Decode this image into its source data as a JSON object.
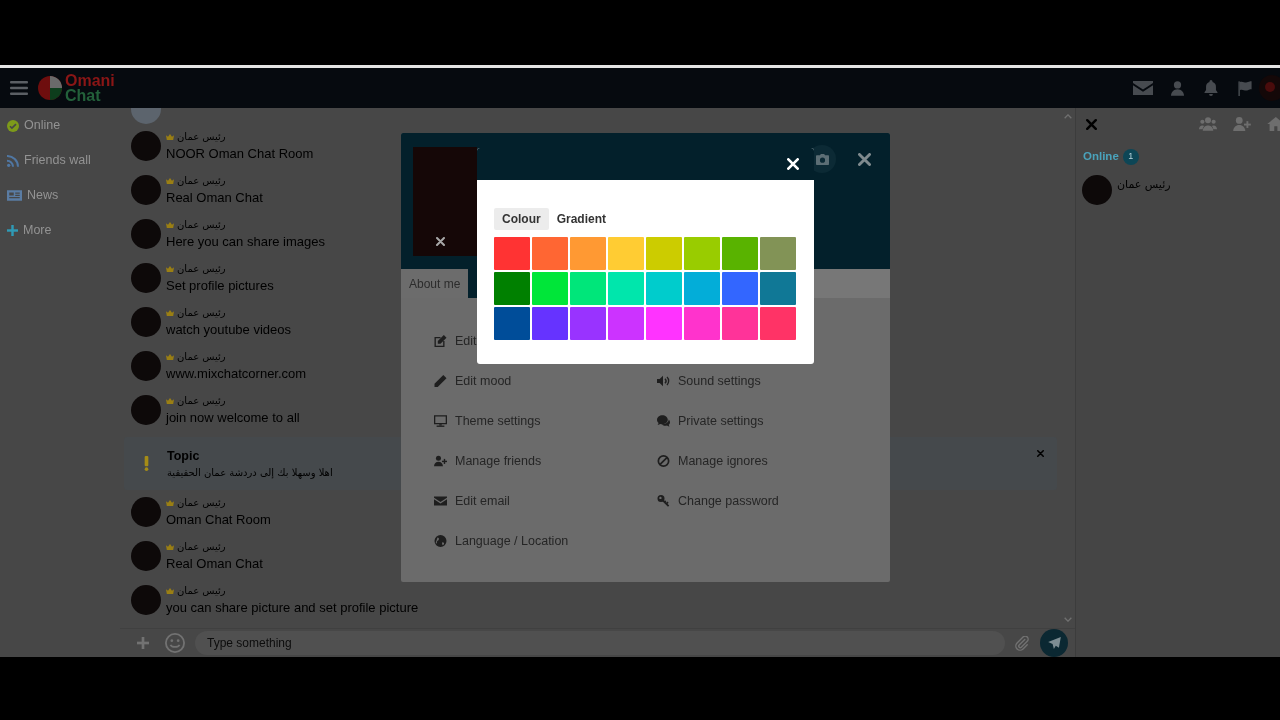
{
  "header": {
    "logo": [
      "Omani",
      "Chat"
    ]
  },
  "sidebar": {
    "items": [
      {
        "label": "Online",
        "kind": "online"
      },
      {
        "label": "Friends wall",
        "kind": "wall"
      },
      {
        "label": "News",
        "kind": "news"
      },
      {
        "label": "More",
        "kind": "more"
      }
    ]
  },
  "chat": {
    "messages": [
      {
        "kind": "message",
        "user": "رئيس عمان",
        "text": "NOOR Oman Chat Room"
      },
      {
        "kind": "message",
        "user": "رئيس عمان",
        "text": "Real Oman Chat"
      },
      {
        "kind": "message",
        "user": "رئيس عمان",
        "text": "Here you can share images"
      },
      {
        "kind": "message",
        "user": "رئيس عمان",
        "text": "Set profile pictures"
      },
      {
        "kind": "message",
        "user": "رئيس عمان",
        "text": "watch youtube videos"
      },
      {
        "kind": "message",
        "user": "رئيس عمان",
        "text": "www.mixchatcorner.com"
      },
      {
        "kind": "message",
        "user": "رئيس عمان",
        "text": "join now welcome to all"
      },
      {
        "kind": "topic",
        "title": "Topic",
        "text": "اهلا وسهلا بك إلى دردشة عمان الحقيقية"
      },
      {
        "kind": "message",
        "user": "رئيس عمان",
        "text": "Oman Chat Room"
      },
      {
        "kind": "message",
        "user": "رئيس عمان",
        "text": "Real Oman Chat"
      },
      {
        "kind": "message",
        "user": "رئيس عمان",
        "text": "you can share picture and set profile picture"
      }
    ]
  },
  "input": {
    "placeholder": "Type something"
  },
  "user_panel": {
    "online": {
      "label": "Online",
      "count": "1"
    },
    "users": [
      {
        "name": "رئيس عمان"
      }
    ]
  },
  "profile": {
    "tabs": [
      {
        "label": "About me",
        "selected": false
      }
    ],
    "menu_rows": [
      [
        {
          "label": "Edit",
          "kind": "edit"
        }
      ],
      [
        {
          "label": "Edit mood",
          "kind": "mood"
        },
        {
          "label": "Sound settings",
          "kind": "sound"
        }
      ],
      [
        {
          "label": "Theme settings",
          "kind": "theme"
        },
        {
          "label": "Private settings",
          "kind": "private"
        }
      ],
      [
        {
          "label": "Manage friends",
          "kind": "friends"
        },
        {
          "label": "Manage ignores",
          "kind": "ignores"
        }
      ],
      [
        {
          "label": "Edit email",
          "kind": "email"
        },
        {
          "label": "Change password",
          "kind": "password"
        }
      ],
      [
        {
          "label": "Language / Location",
          "kind": "language"
        }
      ]
    ]
  },
  "colour_picker": {
    "tabs": [
      {
        "label": "Colour",
        "selected": true
      },
      {
        "label": "Gradient",
        "selected": false
      }
    ],
    "swatches": [
      {
        "color": "#ff3333"
      },
      {
        "color": "#ff6633"
      },
      {
        "color": "#ff9933"
      },
      {
        "color": "#ffcc33"
      },
      {
        "color": "#cccc00"
      },
      {
        "color": "#99cc00"
      },
      {
        "color": "#59b300"
      },
      {
        "color": "#829356"
      },
      {
        "color": "#008000"
      },
      {
        "color": "#00e639"
      },
      {
        "color": "#00e67a"
      },
      {
        "color": "#00e6ac"
      },
      {
        "color": "#00cccc"
      },
      {
        "color": "#03add8"
      },
      {
        "color": "#3366ff"
      },
      {
        "color": "#107896"
      },
      {
        "color": "#004d99"
      },
      {
        "color": "#6633ff"
      },
      {
        "color": "#9933ff"
      },
      {
        "color": "#cc33ff"
      },
      {
        "color": "#ff33ff"
      },
      {
        "color": "#ff33cc"
      },
      {
        "color": "#ff3399"
      },
      {
        "color": "#ff3366"
      }
    ]
  }
}
